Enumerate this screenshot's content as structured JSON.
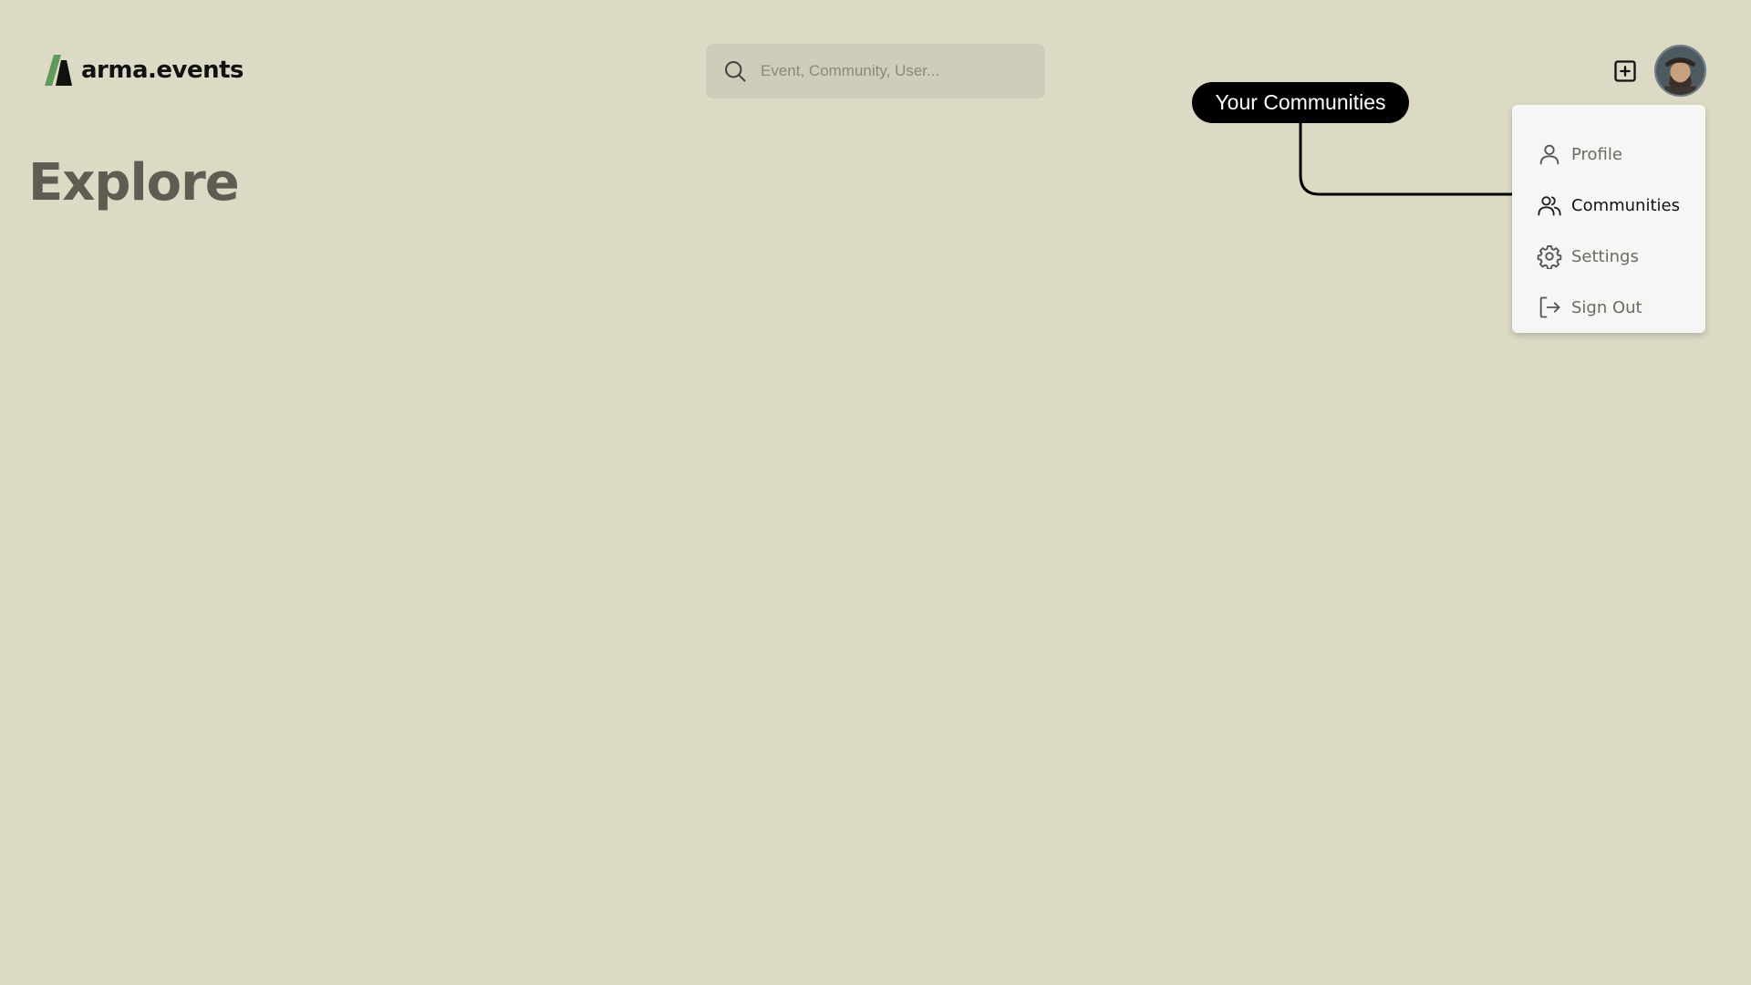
{
  "header": {
    "brand": "arma.events",
    "search": {
      "placeholder": "Event, Community, User..."
    }
  },
  "main": {
    "title": "Explore"
  },
  "callout": {
    "label": "Your Communities"
  },
  "user_menu": {
    "items": [
      {
        "label": "Profile",
        "icon": "user-icon"
      },
      {
        "label": "Communities",
        "icon": "users-icon",
        "active": true
      },
      {
        "label": "Settings",
        "icon": "gear-icon"
      },
      {
        "label": "Sign Out",
        "icon": "sign-out-icon"
      }
    ]
  },
  "colors": {
    "background": "#dcdac5",
    "brand_green": "#5f9a5a",
    "title_gray": "#5e5d52",
    "menu_bg": "#f6f6f4"
  }
}
